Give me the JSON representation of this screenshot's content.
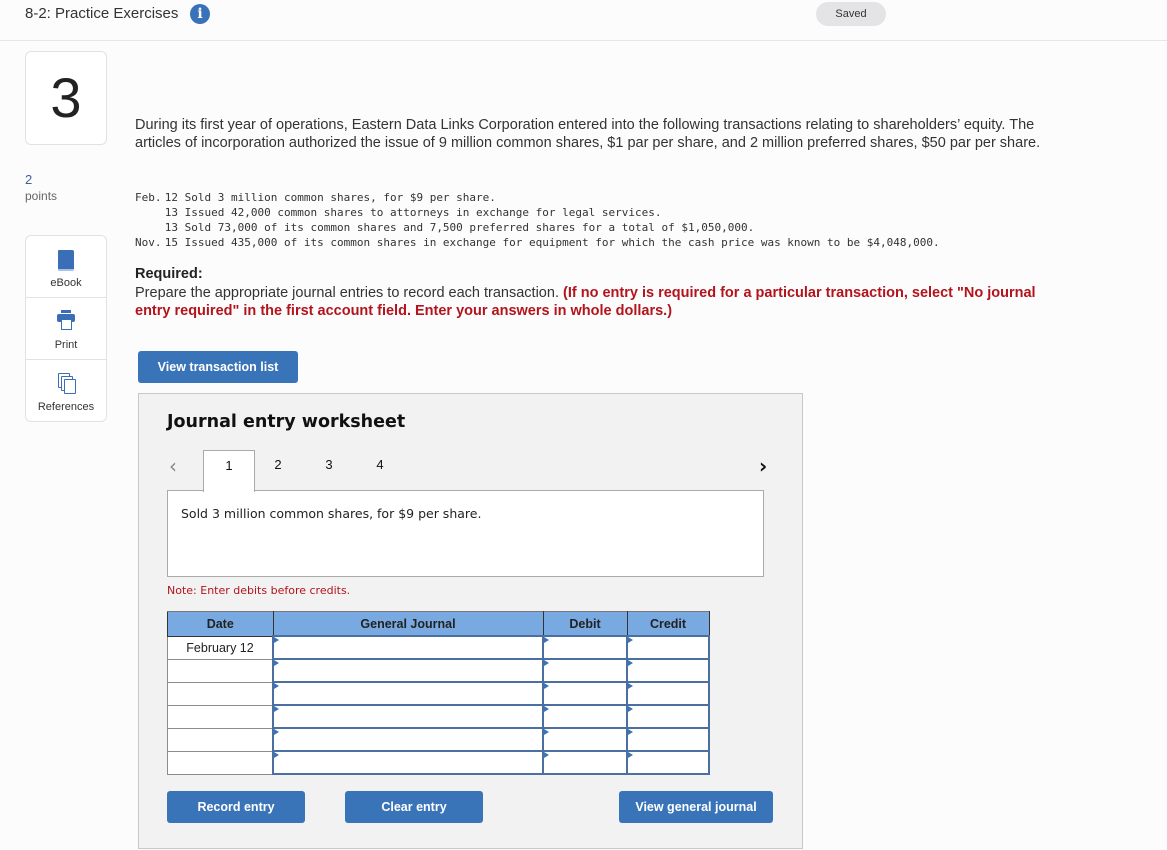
{
  "header": {
    "title": "8-2: Practice Exercises",
    "info_icon": "info-icon",
    "status": "Saved"
  },
  "question": {
    "number": "3",
    "points_value": "2",
    "points_label": "points"
  },
  "tools": [
    {
      "label": "eBook",
      "icon": "book-icon"
    },
    {
      "label": "Print",
      "icon": "printer-icon"
    },
    {
      "label": "References",
      "icon": "references-icon"
    }
  ],
  "problem": {
    "intro": "During its first year of operations, Eastern Data Links Corporation entered into the following transactions relating to shareholders’ equity. The articles of incorporation authorized the issue of 9 million common shares, $1 par per share, and 2 million preferred shares, $50 par per share.",
    "transactions": [
      {
        "month": "Feb.",
        "day": "12",
        "text": "Sold 3 million common shares, for $9 per share."
      },
      {
        "month": "",
        "day": "13",
        "text": "Issued 42,000 common shares to attorneys in exchange for legal services."
      },
      {
        "month": "",
        "day": "13",
        "text": "Sold 73,000 of its common shares and 7,500 preferred shares for a total of $1,050,000."
      },
      {
        "month": "Nov.",
        "day": "15",
        "text": "Issued 435,000 of its common shares in exchange for equipment for which the cash price was known to be $4,048,000."
      }
    ],
    "required_heading": "Required:",
    "required_text": "Prepare the appropriate journal entries to record each transaction. ",
    "required_instruction": "(If no entry is required for a particular transaction, select \"No journal entry required\" in the first account field. Enter your answers in whole dollars.)"
  },
  "buttons": {
    "view_transaction_list": "View transaction list",
    "record_entry": "Record entry",
    "clear_entry": "Clear entry",
    "view_general_journal": "View general journal"
  },
  "worksheet": {
    "title": "Journal entry worksheet",
    "prev_arrow": "‹",
    "next_arrow": "›",
    "tabs": [
      "1",
      "2",
      "3",
      "4"
    ],
    "active_tab": "1",
    "description": "Sold 3 million common shares, for $9 per share.",
    "note": "Note: Enter debits before credits.",
    "columns": [
      "Date",
      "General Journal",
      "Debit",
      "Credit"
    ],
    "rows": [
      {
        "date": "February 12",
        "account": "",
        "debit": "",
        "credit": ""
      },
      {
        "date": "",
        "account": "",
        "debit": "",
        "credit": ""
      },
      {
        "date": "",
        "account": "",
        "debit": "",
        "credit": ""
      },
      {
        "date": "",
        "account": "",
        "debit": "",
        "credit": ""
      },
      {
        "date": "",
        "account": "",
        "debit": "",
        "credit": ""
      },
      {
        "date": "",
        "account": "",
        "debit": "",
        "credit": ""
      }
    ]
  },
  "colors": {
    "accent": "#3a74b8",
    "header_blue": "#79a9e1",
    "warning_red": "#b3141c"
  }
}
